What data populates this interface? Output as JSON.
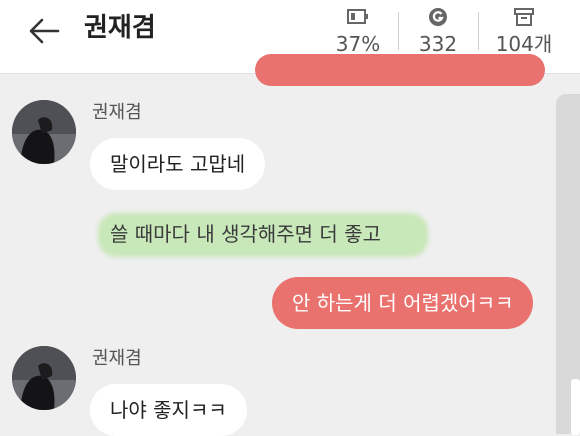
{
  "header": {
    "title": "권재겸",
    "stats": [
      {
        "icon": "battery-icon",
        "value": "37%"
      },
      {
        "icon": "g-coin-icon",
        "value": "332"
      },
      {
        "icon": "archive-box-icon",
        "value": "104개"
      }
    ]
  },
  "chat": {
    "messages": [
      {
        "sender": "권재겸",
        "text": "말이라도 고맙네"
      },
      {
        "text": "쓸 때마다 내 생각해주면 더 좋고"
      },
      {
        "text": "안 하는게 더 어렵겠어ㅋㅋ"
      },
      {
        "sender": "권재겸",
        "text": "나야 좋지ㅋㅋ"
      }
    ]
  },
  "colors": {
    "outgoing_bubble": "#e9726f",
    "incoming_bubble": "#ffffff",
    "background": "#efefef",
    "highlight": "#aae18c"
  }
}
